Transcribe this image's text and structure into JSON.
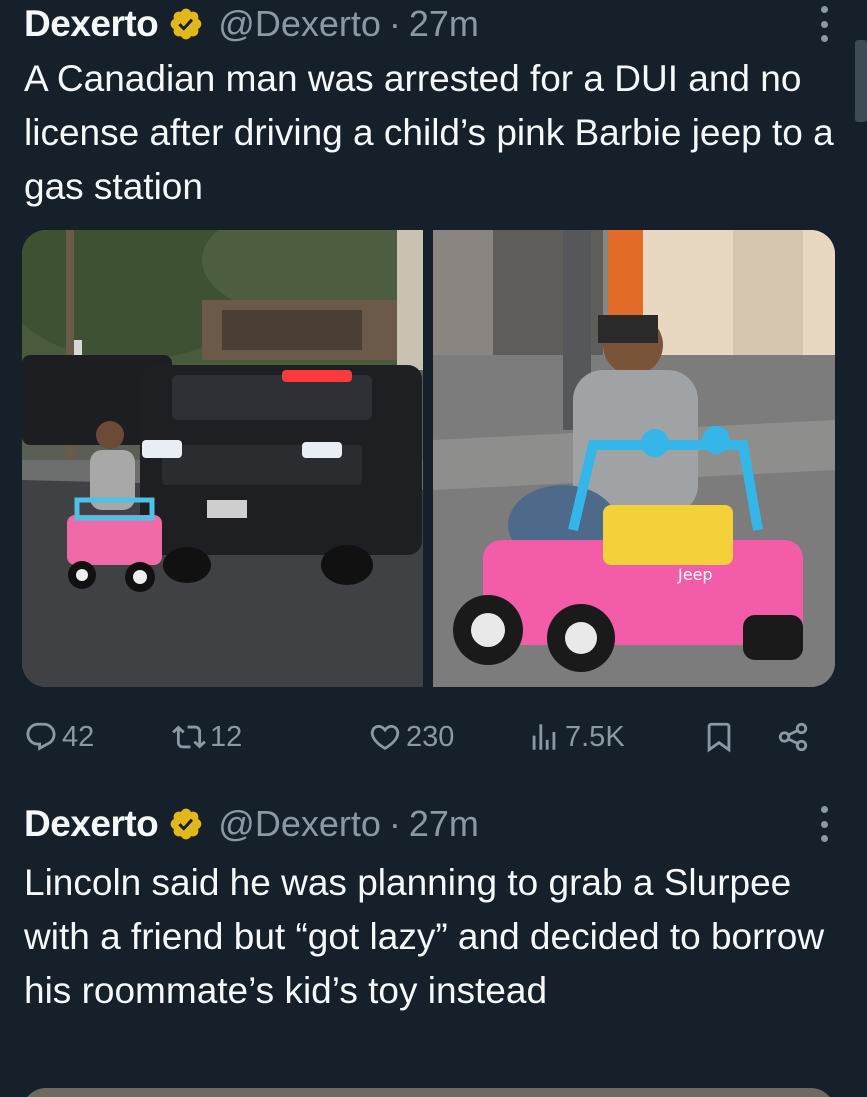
{
  "tweets": [
    {
      "author_name": "Dexerto",
      "handle": "@Dexerto",
      "separator": "·",
      "time": "27m",
      "text": "A Canadian man was arrested for a DUI and no license after driving a child’s pink Barbie jeep to a gas station",
      "stats": {
        "replies": "42",
        "reposts": "12",
        "likes": "230",
        "views": "7.5K"
      },
      "photo_right_text": "Jeep"
    },
    {
      "author_name": "Dexerto",
      "handle": "@Dexerto",
      "separator": "·",
      "time": "27m",
      "text": "Lincoln said he was planning to grab a Slurpee with a friend but “got lazy” and decided to borrow his roommate’s kid’s toy instead"
    }
  ],
  "colors": {
    "background": "#15202b",
    "text_primary": "#f7f9f9",
    "text_secondary": "#8b98a5",
    "verified_badge": "#e2b719"
  },
  "icons": {
    "verified": "verified-badge-icon",
    "more": "more-options-icon",
    "reply": "reply-icon",
    "repost": "repost-icon",
    "like": "heart-icon",
    "views": "analytics-icon",
    "bookmark": "bookmark-icon",
    "share": "share-icon"
  }
}
